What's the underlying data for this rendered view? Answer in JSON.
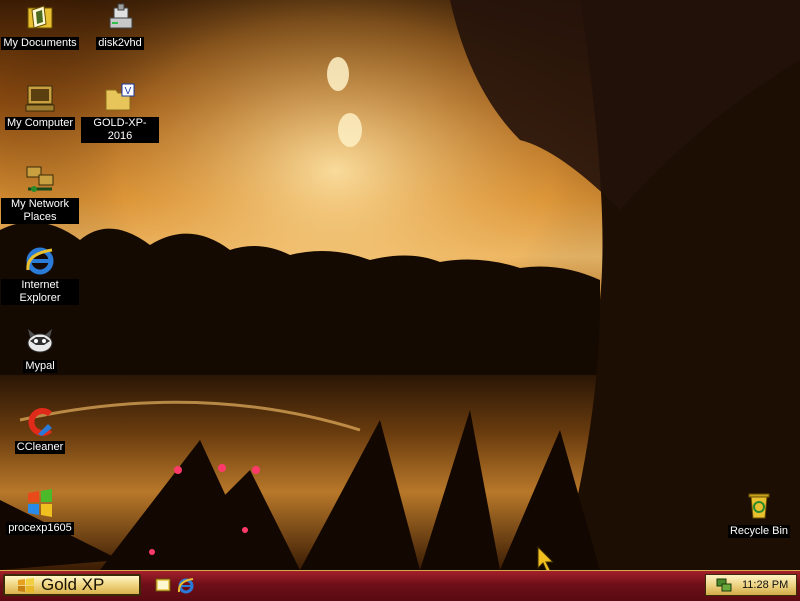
{
  "desktop": {
    "icons": [
      {
        "label": "My Documents",
        "icon": "my-documents-icon"
      },
      {
        "label": "disk2vhd",
        "icon": "disk2vhd-icon"
      },
      {
        "label": "My Computer",
        "icon": "my-computer-icon"
      },
      {
        "label": "GOLD-XP-2016",
        "icon": "folder-icon"
      },
      {
        "label": "My Network Places",
        "icon": "network-places-icon"
      },
      {
        "label": "Internet Explorer",
        "icon": "internet-explorer-icon"
      },
      {
        "label": "Mypal",
        "icon": "mypal-icon"
      },
      {
        "label": "CCleaner",
        "icon": "ccleaner-icon"
      },
      {
        "label": "procexp1605",
        "icon": "procexp-icon"
      },
      {
        "label": "Recycle Bin",
        "icon": "recycle-bin-icon"
      }
    ]
  },
  "taskbar": {
    "start_label": "Gold XP",
    "quick_launch": [
      "show-desktop-icon",
      "internet-explorer-icon"
    ],
    "clock": "11:28 PM"
  },
  "colors": {
    "taskbar": "#8a1620",
    "start_button": "#f0d480",
    "icon_label_bg": "#000000"
  }
}
